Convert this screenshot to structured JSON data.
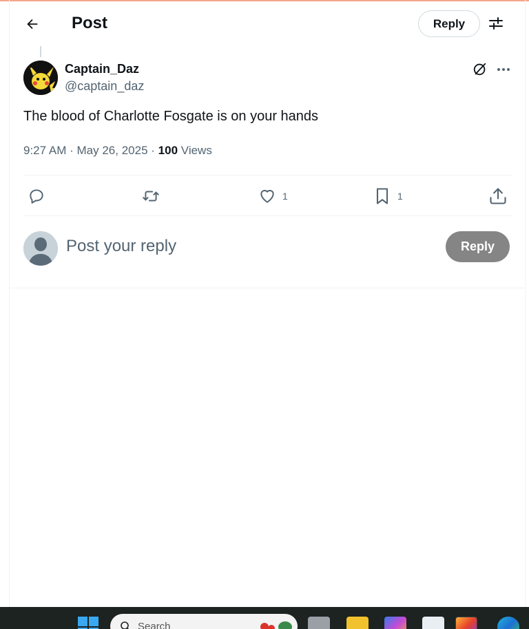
{
  "header": {
    "title": "Post",
    "reply_label": "Reply",
    "back_icon": "arrow-left-icon",
    "settings_icon": "sliders-icon"
  },
  "post": {
    "display_name": "Captain_Daz",
    "handle": "@captain_daz",
    "text": "The blood of Charlotte Fosgate is on your hands",
    "time": "9:27 AM",
    "date": "May 26, 2025",
    "views_count": "100",
    "views_label": "Views",
    "separator": "·"
  },
  "actions": {
    "reply_count": "",
    "repost_count": "",
    "like_count": "1",
    "bookmark_count": "1"
  },
  "composer": {
    "placeholder": "Post your reply",
    "reply_button": "Reply"
  },
  "taskbar": {
    "search_placeholder": "Search"
  },
  "colors": {
    "text_primary": "#0f1419",
    "text_secondary": "#536471",
    "border": "#eff3f4",
    "reply_button_disabled": "#858585",
    "taskbar": "#1c2320"
  }
}
